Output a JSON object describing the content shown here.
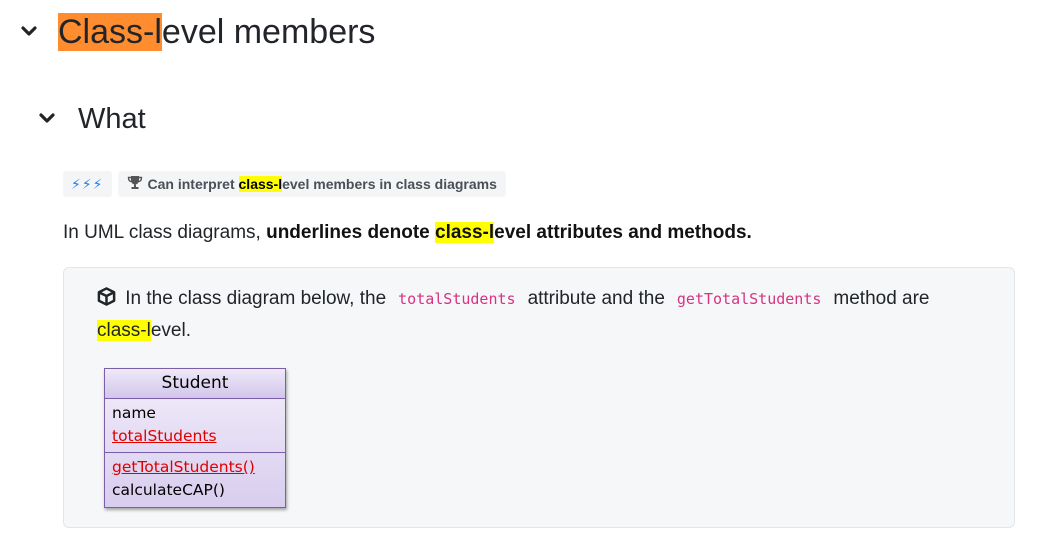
{
  "section": {
    "title_highlight": "Class-l",
    "title_rest": "evel members"
  },
  "subsection": {
    "title": "What"
  },
  "outcome": {
    "stars": "⚡⚡⚡",
    "prefix": "Can interpret ",
    "highlight": "class-l",
    "suffix": "evel members in class diagrams",
    "icon": "trophy-icon"
  },
  "intro": {
    "text_before": "In UML class diagrams, ",
    "bold_before": "underlines denote ",
    "bold_highlight": "class-l",
    "bold_after": "evel attributes and methods."
  },
  "example": {
    "icon": "cube-icon",
    "text1": " In the class diagram below, the",
    "code1": "totalStudents",
    "text2": "attribute and the",
    "code2": "getTotalStudents",
    "text3": "method are",
    "highlight": "class-l",
    "text4": "evel."
  },
  "uml_class": {
    "name": "Student",
    "attributes": [
      {
        "text": "name",
        "static": false
      },
      {
        "text": "totalStudents",
        "static": true
      }
    ],
    "methods": [
      {
        "text": "getTotalStudents()",
        "static": true
      },
      {
        "text": "calculateCAP()",
        "static": false
      }
    ],
    "static_color": "#e00000"
  },
  "colors": {
    "highlight_orange": "#ff8c2e",
    "highlight_yellow": "#ffff00",
    "code_pink": "#d63384",
    "star_blue": "#2b7de9"
  }
}
